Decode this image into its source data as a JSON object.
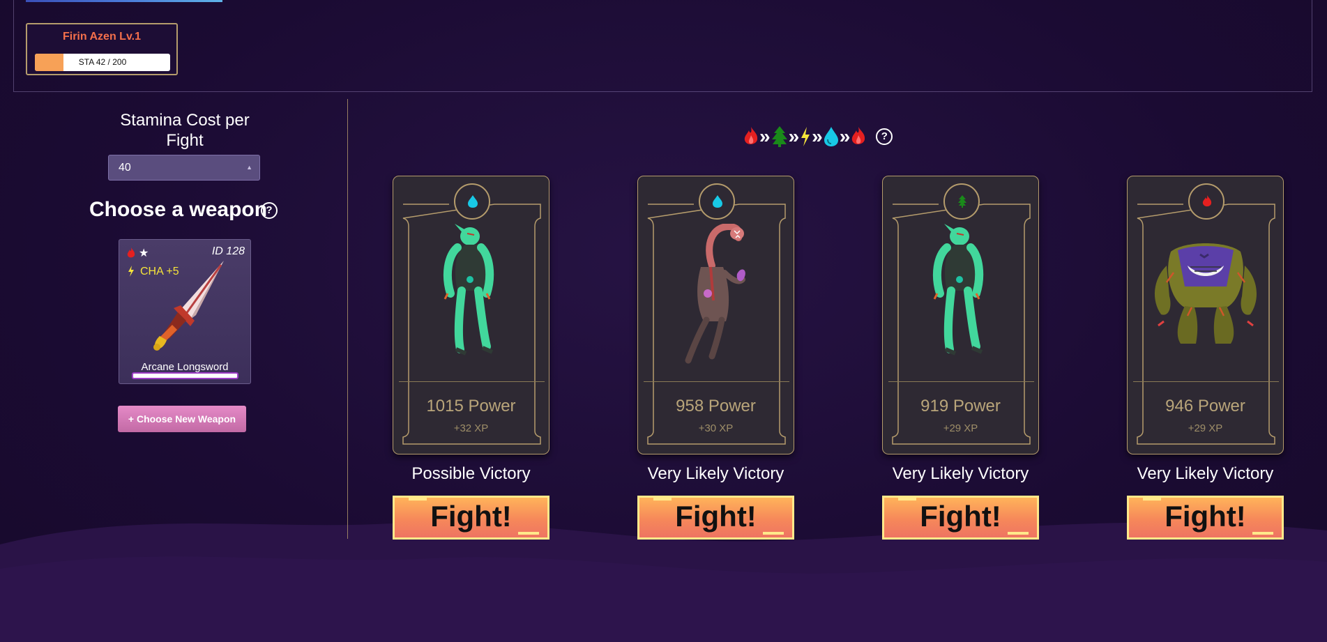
{
  "character": {
    "name_level": "Firin Azen Lv.1",
    "stamina_text": "STA 42 / 200",
    "stamina_fraction": 0.21
  },
  "stamina_cost": {
    "label": "Stamina Cost per Fight",
    "selected": "40"
  },
  "weapon_section": {
    "title": "Choose a weapon",
    "help": "?"
  },
  "weapon": {
    "id_text": "ID 128",
    "star": "★",
    "stat": "CHA +5",
    "name": "Arcane Longsword",
    "element_icon": "fire-icon",
    "stat_icon": "lightning-icon"
  },
  "new_weapon_button": "+ Choose New Weapon",
  "element_chain": {
    "icons": [
      "fire-icon",
      "earth-icon",
      "lightning-icon",
      "water-icon",
      "fire-icon"
    ],
    "separator": "»",
    "help": "?"
  },
  "enemies": [
    {
      "element": "water",
      "power": "1015 Power",
      "xp": "+32 XP",
      "odds": "Possible Victory",
      "fight": "Fight!"
    },
    {
      "element": "water",
      "power": "958 Power",
      "xp": "+30 XP",
      "odds": "Very Likely Victory",
      "fight": "Fight!"
    },
    {
      "element": "earth",
      "power": "919 Power",
      "xp": "+29 XP",
      "odds": "Very Likely Victory",
      "fight": "Fight!"
    },
    {
      "element": "fire",
      "power": "946 Power",
      "xp": "+29 XP",
      "odds": "Very Likely Victory",
      "fight": "Fight!"
    }
  ],
  "colors": {
    "fire": "#e52020",
    "earth": "#1a7a1a",
    "lightning": "#f5e33a",
    "water": "#18c9e6",
    "gold_border": "#b59c6c"
  }
}
